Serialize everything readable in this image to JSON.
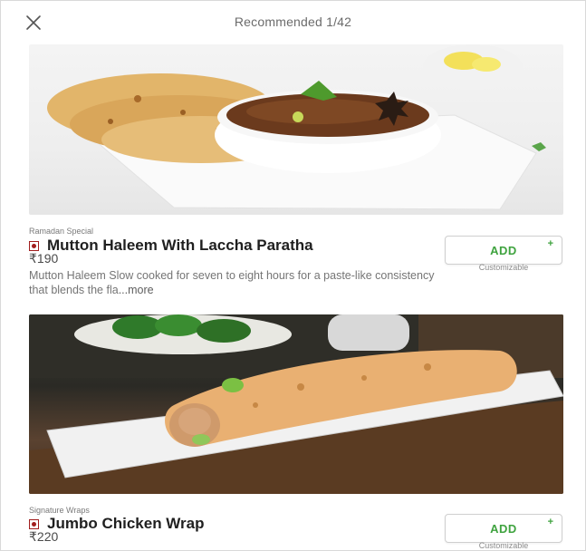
{
  "header": {
    "title": "Recommended 1/42"
  },
  "items": [
    {
      "tag": "Ramadan Special",
      "name": "Mutton Haleem With Laccha Paratha",
      "price": "₹190",
      "description": "Mutton Haleem Slow cooked for seven to eight hours for a paste-like consistency that blends the fla",
      "more": "...more",
      "add_label": "ADD",
      "add_plus": "+",
      "customizable": "Customizable"
    },
    {
      "tag": "Signature Wraps",
      "name": "Jumbo Chicken Wrap",
      "price": "₹220",
      "add_label": "ADD",
      "add_plus": "+",
      "customizable": "Customizable"
    }
  ],
  "colors": {
    "accent_green": "#3fa33f",
    "nonveg_mark": "#a11d1d"
  },
  "icons": {
    "close": "close-icon",
    "food_type": "nonveg-icon"
  }
}
